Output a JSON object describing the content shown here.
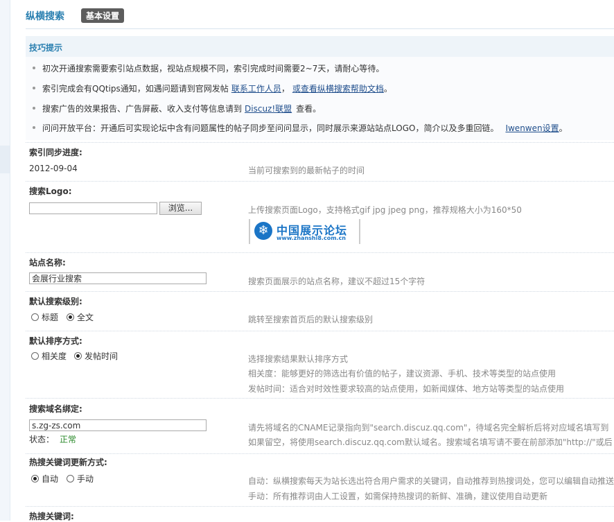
{
  "header": {
    "title": "纵横搜索",
    "tab": "基本设置"
  },
  "tips": {
    "heading": "技巧提示",
    "items": [
      {
        "text": "初次开通搜索需要索引站点数据，视站点规模不同，索引完成时间需要2~7天，请耐心等待。"
      },
      {
        "text": "索引完成会有QQtips通知，如遇问题请到官网发帖",
        "link1": "联系工作人员",
        "sep": "，",
        "link2": "或查看纵横搜索帮助文档",
        "tail": "。"
      },
      {
        "text": "搜索广告的效果报告、广告屏蔽、收入支付等信息请到",
        "link1": "Discuz!联盟",
        "tail": "查看。"
      },
      {
        "text": "问问开放平台：开通后可实现论坛中含有问题属性的帖子同步至问问显示，同时展示来源站站点LOGO，简介以及多重回链。",
        "link1": "Iwenwen设置",
        "tail": "。"
      }
    ]
  },
  "sync": {
    "label": "索引同步进度:",
    "value": "2012-09-04",
    "desc": "当前可搜索到的最新帖子的时间"
  },
  "logo": {
    "label": "搜索Logo:",
    "file_value": "",
    "browse": "浏览...",
    "desc": "上传搜索页面Logo，支持格式gif jpg jpeg png，推荐规格大小为160*50",
    "preview_big": "中国展示论坛",
    "preview_small": "www.zhanshi8.com.cn"
  },
  "sitename": {
    "label": "站点名称:",
    "value": "会展行业搜索",
    "desc": "搜索页面展示的站点名称，建议不超过15个字符"
  },
  "level": {
    "label": "默认搜索级别:",
    "options": [
      "标题",
      "全文"
    ],
    "selected": "全文",
    "desc": "跳转至搜索首页后的默认搜索级别"
  },
  "order": {
    "label": "默认排序方式:",
    "options": [
      "相关度",
      "发帖时间"
    ],
    "selected": "发帖时间",
    "desc1": "选择搜索结果默认排序方式",
    "desc2": "相关度：能够更好的筛选出有价值的帖子，建议资源、手机、技术等类型的站点使用",
    "desc3": "发帖时间：适合对时效性要求较高的站点使用，如新闻媒体、地方站等类型的站点使用"
  },
  "domain": {
    "label": "搜索域名绑定:",
    "value": "s.zg-zs.com",
    "status_label": "状态：",
    "status_value": "正常",
    "desc1": "请先将域名的CNAME记录指向到\"search.discuz.qq.com\"，待域名完全解析后将对应域名填写到",
    "desc2": "如果留空，将使用search.discuz.qq.com默认域名。搜索域名填写请不要在前部添加\"http://\"或后"
  },
  "hotupdate": {
    "label": "热搜关键词更新方式:",
    "options": [
      "自动",
      "手动"
    ],
    "selected": "自动",
    "desc1": "自动：纵横搜索每天为站长选出符合用户需求的关键词，自动推荐到热搜词处，您可以编辑自动推送",
    "desc2": "手动：所有推荐词由人工设置，如需保持热搜词的新鲜、准确，建议使用自动更新"
  },
  "hotwords": {
    "label": "热搜关键词:"
  }
}
